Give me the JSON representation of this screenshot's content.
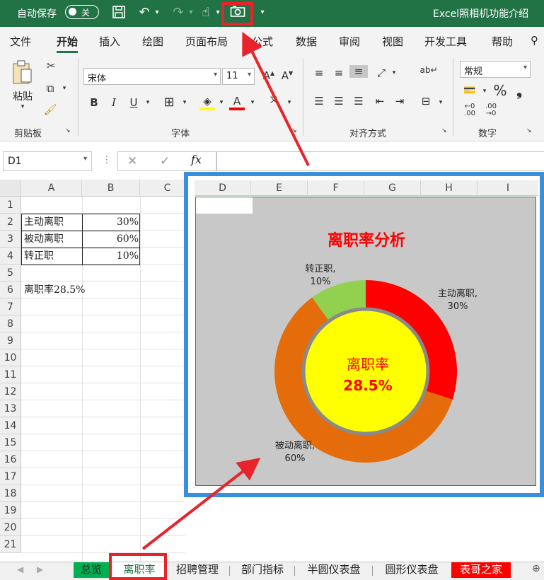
{
  "titlebar": {
    "autosave_label": "自动保存",
    "toggle_state": "关",
    "doc_title": "Excel照相机功能介绍"
  },
  "menu": {
    "tabs": [
      "文件",
      "开始",
      "插入",
      "绘图",
      "页面布局",
      "公式",
      "数据",
      "审阅",
      "视图",
      "开发工具",
      "帮助"
    ],
    "active": "开始"
  },
  "ribbon": {
    "paste_label": "粘贴",
    "font_name": "宋体",
    "font_size": "11",
    "bold": "B",
    "italic": "I",
    "underline": "U",
    "number_format": "常规",
    "percent": "%",
    "groups": {
      "clipboard": "剪贴板",
      "font": "字体",
      "alignment": "对齐方式",
      "number": "数字"
    }
  },
  "formula_bar": {
    "name_box": "D1",
    "fx": "fx",
    "formula": ""
  },
  "columns_left": [
    "A",
    "B",
    "C"
  ],
  "columns_camera": [
    "D",
    "E",
    "F",
    "G",
    "H",
    "I"
  ],
  "rows": [
    "1",
    "2",
    "3",
    "4",
    "5",
    "6",
    "7",
    "8",
    "9",
    "10",
    "11",
    "12",
    "13",
    "14",
    "15",
    "16",
    "17",
    "18",
    "19",
    "20",
    "21"
  ],
  "cells": {
    "a2": "主动离职",
    "b2": "30%",
    "a3": "被动离职",
    "b3": "60%",
    "a4": "转正职",
    "b4": "10%",
    "a6": "离职率28.5%"
  },
  "chart_data": {
    "type": "pie",
    "title": "离职率分析",
    "categories": [
      "主动离职",
      "被动离职",
      "转正职"
    ],
    "values": [
      30,
      60,
      10
    ],
    "data_labels": [
      "主动离职,\n30%",
      "被动离职,\n60%",
      "转正职,\n10%"
    ],
    "center_label": "离职率",
    "center_value": "28.5%",
    "colors": [
      "#ff0000",
      "#e46c0a",
      "#92d050"
    ],
    "center_fill": "#ffff00",
    "background": "#c8c8c8"
  },
  "sheet_tabs": [
    "总览",
    "离职率",
    "招聘管理",
    "部门指标",
    "半圆仪表盘",
    "圆形仪表盘",
    "表哥之家"
  ],
  "active_sheet": "离职率",
  "colors": {
    "excel_green": "#217346",
    "highlight_red": "#e8232a",
    "camera_border": "#3a8fdd"
  }
}
